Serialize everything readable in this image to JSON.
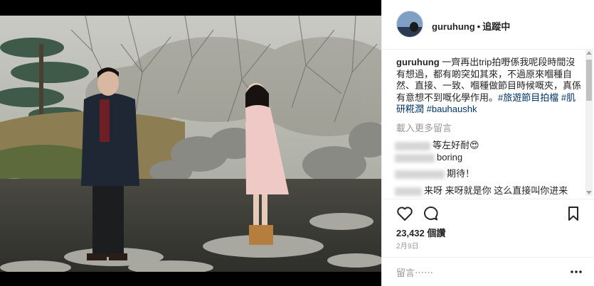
{
  "header": {
    "username": "guruhung",
    "separator": "•",
    "follow_label": "追蹤中"
  },
  "caption": {
    "username": "guruhung",
    "text": "一齊再出trip拍嘢係我呢段時間沒有想過，都有啲突如其來，不過原來嗰種自然、直接、一致、嗰種做節目時候嘅夾，真係有意想不到嘅化學作用。",
    "tags": [
      "#旅遊節目拍檔",
      "#肌研糀潤",
      "#bauhaushk"
    ]
  },
  "load_more_label": "載入更多留言",
  "comments": [
    {
      "text": "等左好耐😍"
    },
    {
      "text": "boring"
    },
    {
      "text": "期待！"
    },
    {
      "text": "来呀 来呀就是你 这么直接叫你进来"
    }
  ],
  "actions": {
    "like_icon": "heart-icon",
    "comment_icon": "speech-bubble-icon",
    "save_icon": "bookmark-icon"
  },
  "views_label": "23,432 個讚",
  "date_label": "2月9日",
  "comment_box": {
    "placeholder": "留言⋯⋯",
    "more_icon": "ellipsis-icon"
  },
  "colors": {
    "link": "#003569",
    "text": "#262626",
    "muted": "#999999",
    "border": "#efefef"
  }
}
